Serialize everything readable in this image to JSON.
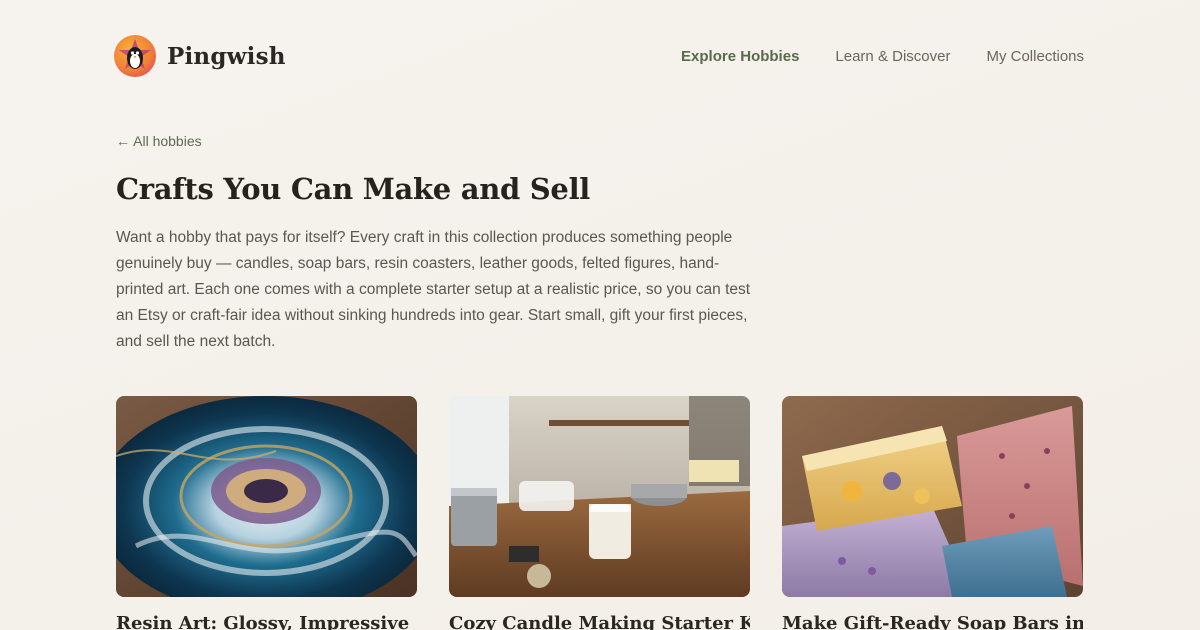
{
  "brand": {
    "name": "Pingwish",
    "logo_icon": "penguin-star-logo"
  },
  "nav": {
    "items": [
      {
        "label": "Explore Hobbies",
        "active": true
      },
      {
        "label": "Learn & Discover",
        "active": false
      },
      {
        "label": "My Collections",
        "active": false
      }
    ]
  },
  "back_link": "← All hobbies",
  "page": {
    "title": "Crafts You Can Make and Sell",
    "description": "Want a hobby that pays for itself? Every craft in this collection produces something people genuinely buy — candles, soap bars, resin coasters, leather goods, felted figures, hand-printed art. Each one comes with a complete starter setup at a realistic price, so you can test an Etsy or craft-fair idea without sinking hundreds into gear. Start small, gift your first pieces, and sell the next batch."
  },
  "cards": [
    {
      "title": "Resin Art: Glossy, Impressive",
      "image": "resin-geode-coaster-photo"
    },
    {
      "title": "Cozy Candle Making Starter Kit",
      "image": "candle-making-workbench-photo"
    },
    {
      "title": "Make Gift-Ready Soap Bars in a",
      "image": "handmade-soap-bars-photo"
    }
  ],
  "colors": {
    "background": "#f5f2ec",
    "accent_green": "#5a6a4c",
    "text_dark": "#26231f",
    "text_muted": "#5c5650"
  }
}
